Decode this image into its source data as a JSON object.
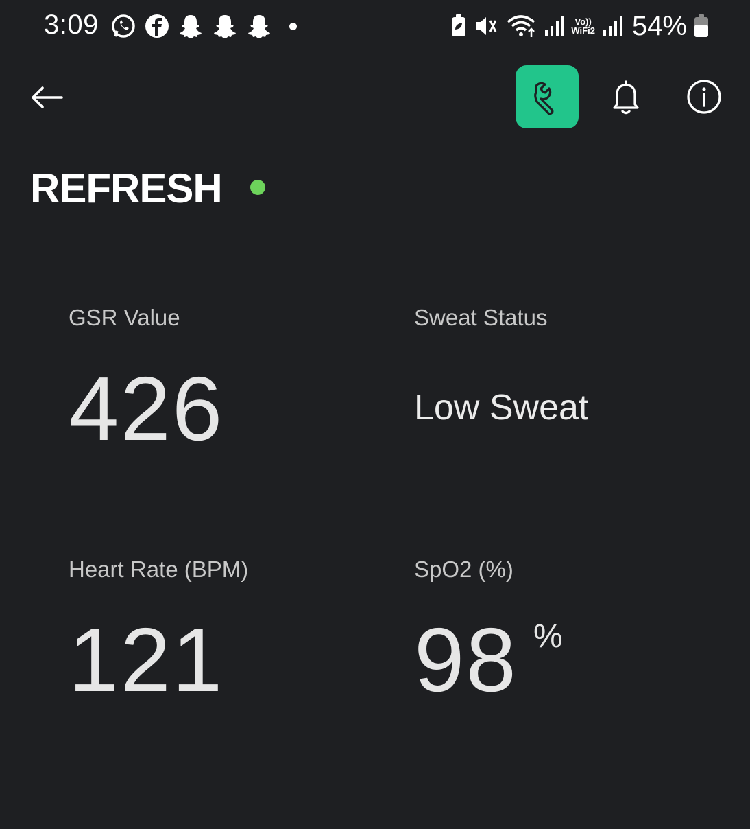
{
  "status_bar": {
    "time": "3:09",
    "left_icons": [
      "whatsapp-icon",
      "facebook-icon",
      "snapchat-icon",
      "snapchat-icon",
      "snapchat-icon",
      "notification-dot-icon"
    ],
    "right_icons": [
      "battery-saver-icon",
      "vibrate-icon",
      "wifi-icon",
      "signal-icon",
      "vowifi-icon",
      "signal-icon",
      "battery-icon"
    ],
    "vowifi_top": "Vo))",
    "vowifi_bottom": "WiFi2",
    "battery_percent": "54%"
  },
  "app_bar": {
    "back_icon": "arrow-left-icon",
    "tools_icon": "wrench-icon",
    "notifications_icon": "bell-icon",
    "info_icon": "info-icon",
    "accent_color": "#22c58b"
  },
  "header": {
    "title": "REFRESH",
    "status_dot_color": "#6dd35b"
  },
  "metrics": {
    "gsr": {
      "label": "GSR Value",
      "value": "426"
    },
    "sweat": {
      "label": "Sweat Status",
      "value": "Low Sweat"
    },
    "heart_rate": {
      "label": "Heart Rate (BPM)",
      "value": "121"
    },
    "spo2": {
      "label": "SpO2 (%)",
      "value": "98",
      "unit": "%"
    }
  }
}
